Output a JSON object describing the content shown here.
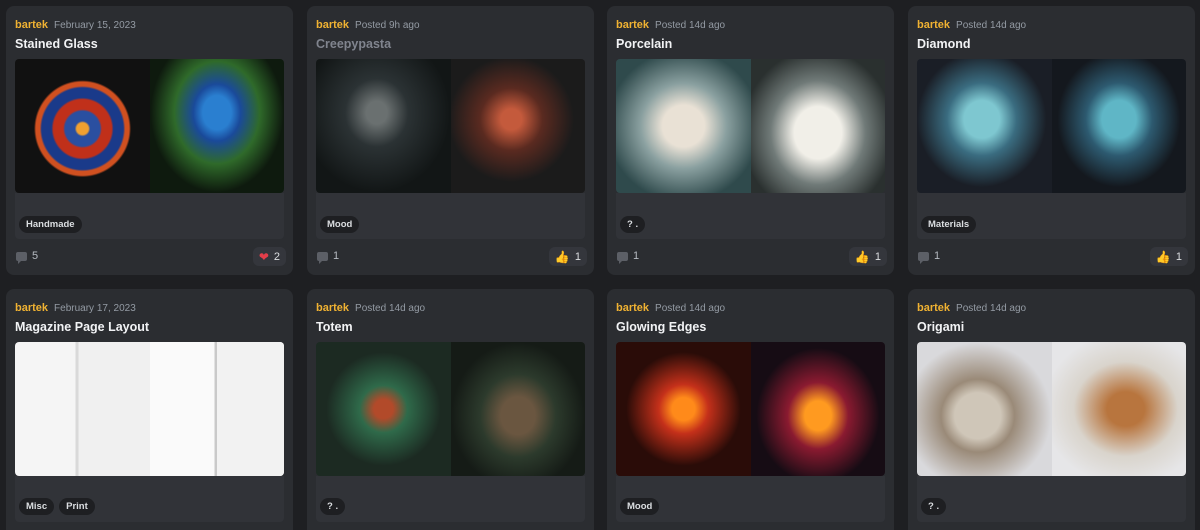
{
  "cards": [
    {
      "author": "bartek",
      "date": "February 15, 2023",
      "title": "Stained Glass",
      "tags": [
        "Handmade"
      ],
      "comments": "5",
      "reaction": {
        "icon": "heart-icon",
        "glyph": "❤",
        "count": "2"
      }
    },
    {
      "author": "bartek",
      "date": "Posted 9h ago",
      "title": "Creepypasta",
      "tags": [
        "Mood"
      ],
      "comments": "1",
      "reaction": {
        "icon": "thumbs-up-icon",
        "glyph": "👍",
        "count": "1"
      }
    },
    {
      "author": "bartek",
      "date": "Posted 14d ago",
      "title": "Porcelain",
      "tags": [
        "? ."
      ],
      "comments": "1",
      "reaction": {
        "icon": "thumbs-up-icon",
        "glyph": "👍",
        "count": "1"
      }
    },
    {
      "author": "bartek",
      "date": "Posted 14d ago",
      "title": "Diamond",
      "tags": [
        "Materials"
      ],
      "comments": "1",
      "reaction": {
        "icon": "thumbs-up-icon",
        "glyph": "👍",
        "count": "1"
      }
    },
    {
      "author": "bartek",
      "date": "February 17, 2023",
      "title": "Magazine Page Layout",
      "tags": [
        "Misc",
        "Print"
      ]
    },
    {
      "author": "bartek",
      "date": "Posted 14d ago",
      "title": "Totem",
      "tags": [
        "? ."
      ]
    },
    {
      "author": "bartek",
      "date": "Posted 14d ago",
      "title": "Glowing Edges",
      "tags": [
        "Mood"
      ]
    },
    {
      "author": "bartek",
      "date": "Posted 14d ago",
      "title": "Origami",
      "tags": [
        "? ."
      ]
    }
  ]
}
